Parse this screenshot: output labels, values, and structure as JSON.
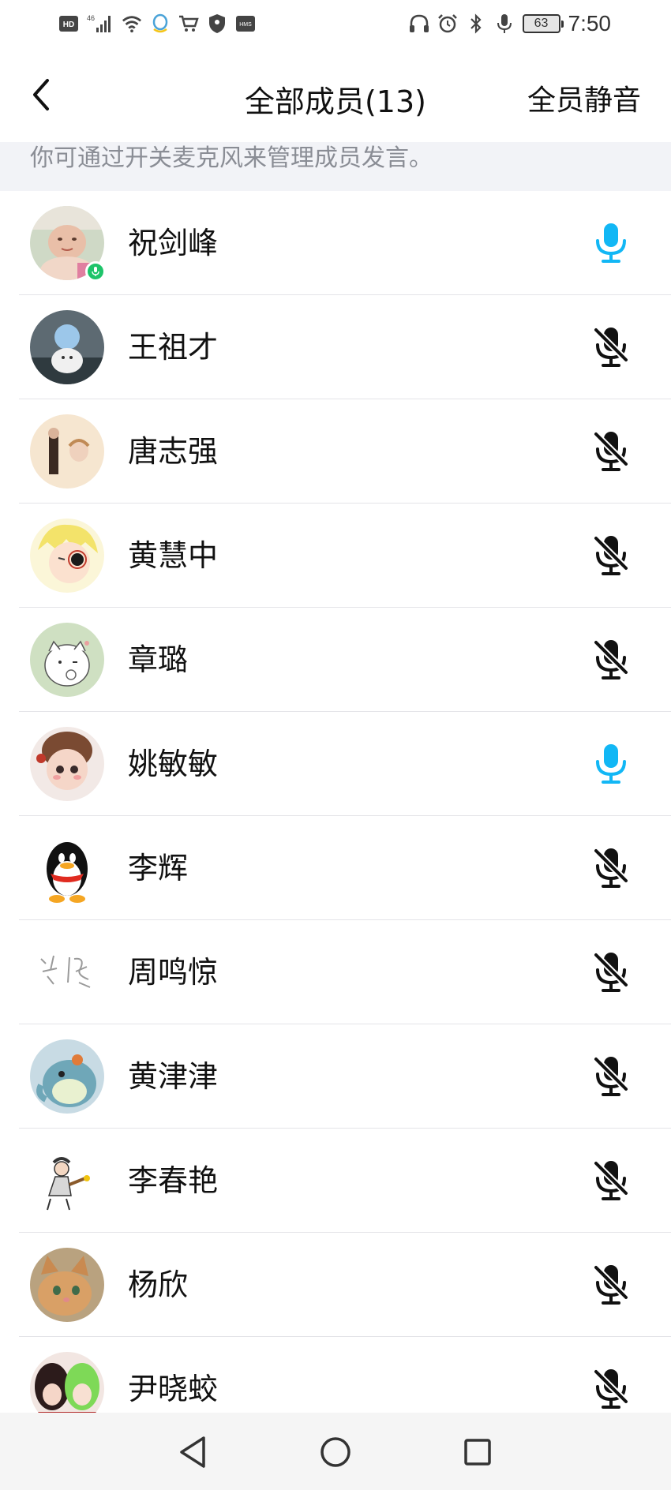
{
  "status_bar": {
    "left_icons": [
      "hd-icon",
      "signal-4g-icon",
      "wifi-icon",
      "qq-icon",
      "cart-icon",
      "shield-icon",
      "hms-icon"
    ],
    "hd_label": "HD",
    "network_label": "46",
    "hms_label": "HMS",
    "right_icons": [
      "headphones-icon",
      "alarm-icon",
      "bluetooth-icon",
      "microphone-icon",
      "battery-icon"
    ],
    "battery_level": "63",
    "time": "7:50"
  },
  "header": {
    "title": "全部成员(13)",
    "action_label": "全员静音"
  },
  "hint": {
    "text": "你可通过开关麦克风来管理成员发言。"
  },
  "colors": {
    "mic_on": "#12b7f5",
    "mic_off": "#111111",
    "speaking_badge": "#1ec46a",
    "hint_bg": "#f2f3f7",
    "hint_text": "#8a8d95"
  },
  "members": [
    {
      "name": "祝剑峰",
      "mic": "on",
      "speaking": true
    },
    {
      "name": "王祖才",
      "mic": "off",
      "speaking": false
    },
    {
      "name": "唐志强",
      "mic": "off",
      "speaking": false
    },
    {
      "name": "黄慧中",
      "mic": "off",
      "speaking": false
    },
    {
      "name": "章璐",
      "mic": "off",
      "speaking": false
    },
    {
      "name": "姚敏敏",
      "mic": "on",
      "speaking": false
    },
    {
      "name": "李辉",
      "mic": "off",
      "speaking": false
    },
    {
      "name": "周鸣惊",
      "mic": "off",
      "speaking": false
    },
    {
      "name": "黄津津",
      "mic": "off",
      "speaking": false
    },
    {
      "name": "李春艳",
      "mic": "off",
      "speaking": false
    },
    {
      "name": "杨欣",
      "mic": "off",
      "speaking": false
    },
    {
      "name": "尹晓蛟",
      "mic": "off",
      "speaking": false
    }
  ],
  "nav": {
    "buttons": [
      "back-triangle-icon",
      "home-circle-icon",
      "recent-square-icon"
    ]
  }
}
